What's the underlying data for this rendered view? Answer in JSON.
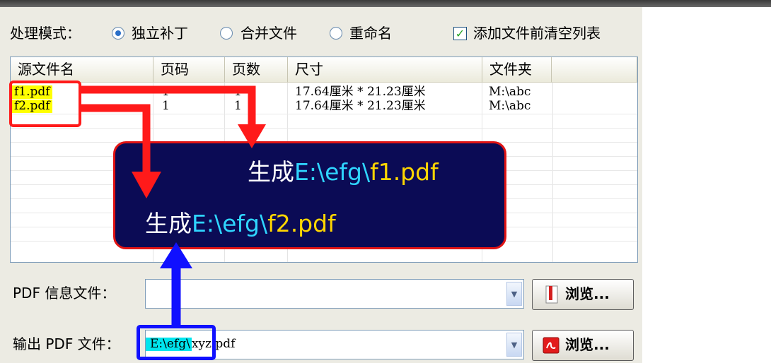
{
  "mode": {
    "label": "处理模式：",
    "options": [
      {
        "label": "独立补丁",
        "selected": true
      },
      {
        "label": "合并文件",
        "selected": false
      },
      {
        "label": "重命名",
        "selected": false
      }
    ],
    "clear_list_label": "添加文件前清空列表",
    "clear_list_checked": true
  },
  "file_list": {
    "columns": [
      "源文件名",
      "页码",
      "页数",
      "尺寸",
      "文件夹"
    ],
    "rows": [
      {
        "name": "f1.pdf",
        "page": "1",
        "count": "1",
        "size": "17.64厘米 * 21.23厘米",
        "folder": "M:\\abc"
      },
      {
        "name": "f2.pdf",
        "page": "1",
        "count": "1",
        "size": "17.64厘米 * 21.23厘米",
        "folder": "M:\\abc"
      }
    ]
  },
  "callout": {
    "line1_prefix": "生成",
    "line1_path": "E:\\efg\\",
    "line1_file": "f1.pdf",
    "line2_prefix": "生成",
    "line2_path": "E:\\efg\\",
    "line2_file": "f2.pdf"
  },
  "pdf_info": {
    "label": "PDF 信息文件：",
    "value": "",
    "browse_label": "浏览..."
  },
  "output": {
    "label": "输出 PDF 文件：",
    "value_highlighted": "E:\\efg\\",
    "value_rest": "xyz.pdf",
    "browse_label": "浏览..."
  },
  "colors": {
    "highlight": "#ffff00",
    "arrow_red": "#ff1a1a",
    "arrow_blue": "#1010ff",
    "output_highlight": "#00e5ee",
    "callout_bg": "#0b0b55"
  }
}
